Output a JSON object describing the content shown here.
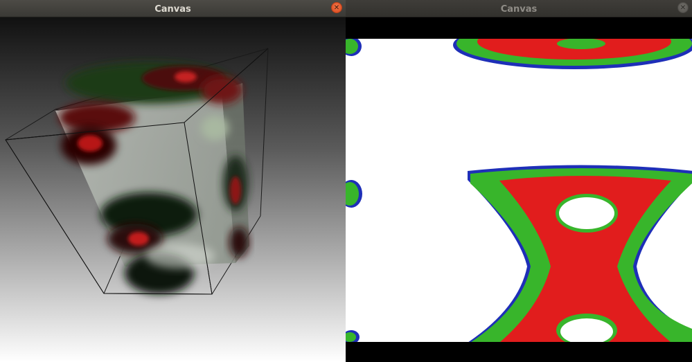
{
  "windows": [
    {
      "title": "Canvas",
      "close_icon": "close-icon",
      "state": "focused"
    },
    {
      "title": "Canvas",
      "close_icon": "close-icon",
      "state": "unfocused"
    }
  ],
  "colors": {
    "close_active": "#e8552a",
    "titlebar": "#45433f",
    "isosurface_red": "#e11d1d",
    "isosurface_green": "#33b32a",
    "isosurface_edge": "#1e2fb8",
    "slice_background": "#ffffff"
  }
}
